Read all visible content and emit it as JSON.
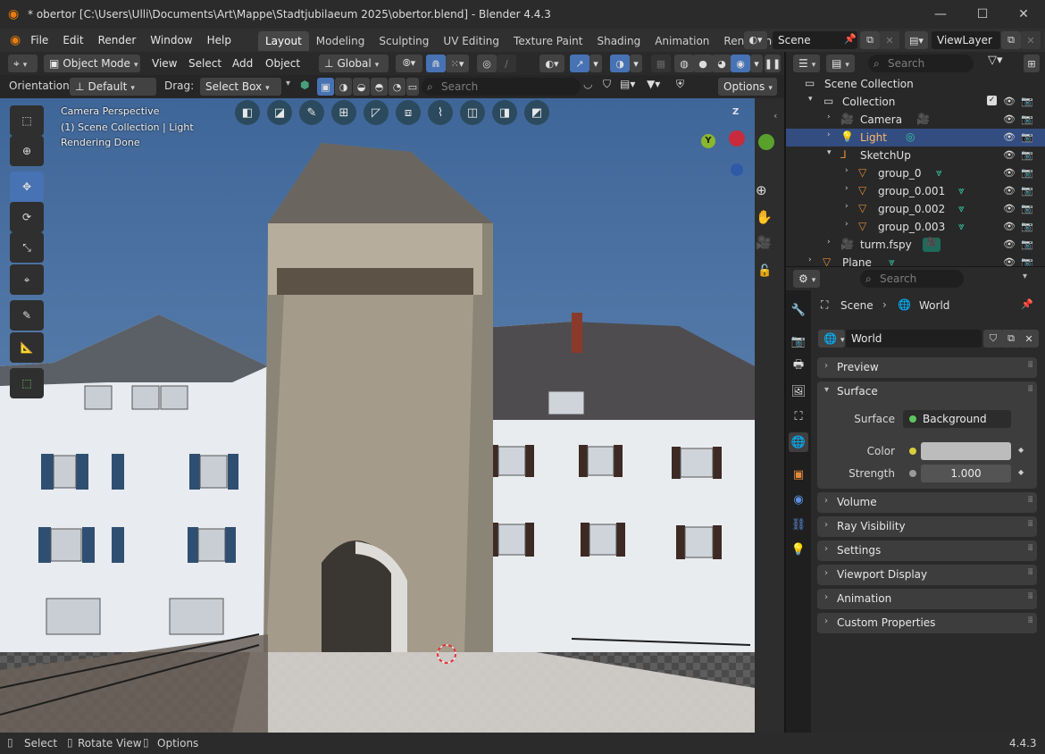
{
  "window": {
    "title": "* obertor [C:\\Users\\Ulli\\Documents\\Art\\Mappe\\Stadtjubilaeum 2025\\obertor.blend] - Blender 4.4.3",
    "minimize": "—",
    "maximize": "☐",
    "close": "✕"
  },
  "menubar": {
    "menus": [
      "File",
      "Edit",
      "Render",
      "Window",
      "Help"
    ],
    "workspaces": [
      "Layout",
      "Modeling",
      "Sculpting",
      "UV Editing",
      "Texture Paint",
      "Shading",
      "Animation",
      "Rendering"
    ],
    "active_workspace": "Layout",
    "scene": "Scene",
    "view_layer": "ViewLayer"
  },
  "viewport_header": {
    "mode": "Object Mode",
    "menus": [
      "View",
      "Select",
      "Add",
      "Object"
    ],
    "transform_orientation": "Global"
  },
  "tool_settings": {
    "orientation_label": "Orientation:",
    "orientation_value": "Default",
    "drag_label": "Drag:",
    "drag_value": "Select Box",
    "search_placeholder": "Search",
    "options_label": "Options"
  },
  "viewport": {
    "overlay_line1": "Camera Perspective",
    "overlay_line2": "(1) Scene Collection | Light",
    "overlay_line3": "Rendering Done",
    "gizmo": {
      "z": "Z",
      "y": "Y"
    },
    "colors": {
      "gizmo_x": "#c72b3c",
      "gizmo_y": "#8ab82c",
      "gizmo_z": "#2f6bd0",
      "sky": "#4a6fa3"
    }
  },
  "outliner": {
    "search_placeholder": "Search",
    "rows": [
      {
        "label": "Scene Collection",
        "icon": "scene-collection-icon"
      },
      {
        "label": "Collection",
        "icon": "collection-icon"
      },
      {
        "label": "Camera",
        "icon": "camera-icon"
      },
      {
        "label": "Light",
        "icon": "light-icon"
      },
      {
        "label": "SketchUp",
        "icon": "empty-icon"
      },
      {
        "label": "group_0",
        "icon": "mesh-icon"
      },
      {
        "label": "group_0.001",
        "icon": "mesh-icon"
      },
      {
        "label": "group_0.002",
        "icon": "mesh-icon"
      },
      {
        "label": "group_0.003",
        "icon": "mesh-icon"
      },
      {
        "label": "turm.fspy",
        "icon": "camera-icon"
      },
      {
        "label": "Plane",
        "icon": "mesh-icon"
      }
    ],
    "selected": "Light"
  },
  "properties": {
    "search_placeholder": "Search",
    "breadcrumb": [
      "Scene",
      "World"
    ],
    "world_name": "World",
    "panels": {
      "preview": "Preview",
      "surface": "Surface",
      "volume": "Volume",
      "ray_visibility": "Ray Visibility",
      "settings": "Settings",
      "viewport_display": "Viewport Display",
      "animation": "Animation",
      "custom_properties": "Custom Properties"
    },
    "surface_label": "Surface",
    "surface_value": "Background",
    "color_label": "Color",
    "strength_label": "Strength",
    "strength_value": "1.000",
    "color_swatch": "#bcbcbc"
  },
  "statusbar": {
    "select": "Select",
    "rotate_view": "Rotate View",
    "options": "Options",
    "version": "4.4.3"
  }
}
